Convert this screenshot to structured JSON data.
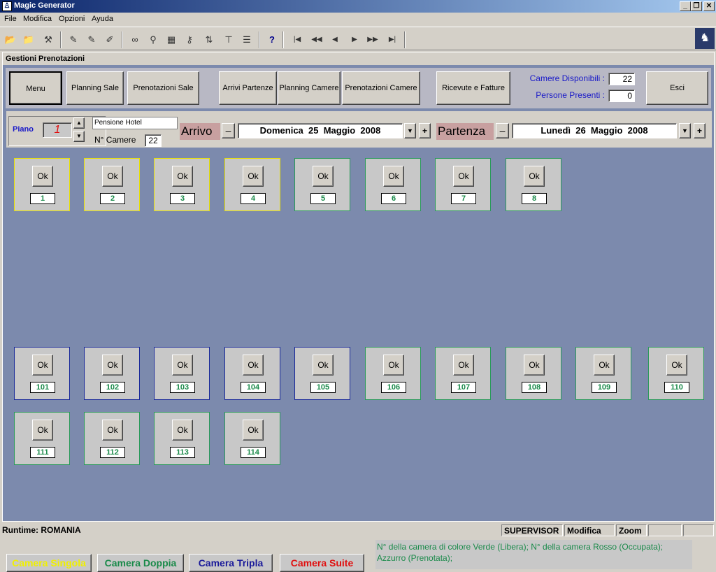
{
  "window": {
    "title": "Magic Generator"
  },
  "menu": [
    "File",
    "Modifica",
    "Opzioni",
    "Ayuda"
  ],
  "panel": {
    "title": "Gestioni Prenotazioni"
  },
  "buttons": {
    "menu": "Menu",
    "planning_sale": "Planning Sale",
    "prenotazioni_sale": "Prenotazioni Sale",
    "arrivi_partenze": "Arrivi Partenze",
    "planning_camere": "Planning Camere",
    "prenotazioni_camere": "Prenotazioni Camere",
    "ricevute_fatture": "Ricevute e Fatture",
    "esci": "Esci"
  },
  "info": {
    "camere_label": "Camere Disponibili :",
    "camere_value": "22",
    "persone_label": "Persone Presenti :",
    "persone_value": "0"
  },
  "floor": {
    "label": "Piano",
    "value": "1",
    "hotel_name": "Pensione Hotel",
    "camere_label": "N° Camere",
    "camere_value": "22"
  },
  "arrivo": {
    "label": "Arrivo",
    "date": "Domenica  25  Maggio  2008",
    "minus": "–",
    "plus": "+"
  },
  "partenza": {
    "label": "Partenza",
    "date": "Lunedì  26  Maggio  2008",
    "minus": "–",
    "plus": "+"
  },
  "ok_label": "Ok",
  "rooms_floor": [
    {
      "num": "1",
      "border": "#e8e000"
    },
    {
      "num": "2",
      "border": "#e8e000"
    },
    {
      "num": "3",
      "border": "#e8e000"
    },
    {
      "num": "4",
      "border": "#e8e000"
    },
    {
      "num": "5",
      "border": "#2a9a5a"
    },
    {
      "num": "6",
      "border": "#2a9a5a"
    },
    {
      "num": "7",
      "border": "#2a9a5a"
    },
    {
      "num": "8",
      "border": "#2a9a5a"
    }
  ],
  "rooms_100": [
    {
      "num": "101",
      "border": "#1a2a9a"
    },
    {
      "num": "102",
      "border": "#1a2a9a"
    },
    {
      "num": "103",
      "border": "#1a2a9a"
    },
    {
      "num": "104",
      "border": "#1a2a9a"
    },
    {
      "num": "105",
      "border": "#1a2a9a"
    },
    {
      "num": "106",
      "border": "#2a9a5a"
    },
    {
      "num": "107",
      "border": "#2a9a5a"
    },
    {
      "num": "108",
      "border": "#2a9a5a"
    },
    {
      "num": "109",
      "border": "#2a9a5a"
    },
    {
      "num": "110",
      "border": "#2a9a5a"
    },
    {
      "num": "111",
      "border": "#2a9a5a"
    },
    {
      "num": "112",
      "border": "#2a9a5a"
    },
    {
      "num": "113",
      "border": "#2a9a5a"
    },
    {
      "num": "114",
      "border": "#2a9a5a"
    }
  ],
  "legend": [
    {
      "label": "Camera Singola",
      "color": "#f0f000"
    },
    {
      "label": "Camera Doppia",
      "color": "#1a8a4a"
    },
    {
      "label": "Camera Tripla",
      "color": "#1a1a9a"
    },
    {
      "label": "Camera Suite",
      "color": "#e01010"
    }
  ],
  "note": "N° della camera di colore Verde (Libera); N° della camera Rosso (Occupata); Azzurro (Prenotata);",
  "status": {
    "runtime": "Runtime: ROMANIA",
    "user": "SUPERVISOR",
    "mode": "Modifica",
    "zoom": "Zoom"
  },
  "toolbar_icons": [
    "open-folder-icon",
    "open-folder-icon",
    "tools-icon",
    "pencil-icon",
    "pencil-add-icon",
    "pencil-icon",
    "binoculars-icon",
    "search-icon",
    "table-icon",
    "key-icon",
    "sort-icon",
    "filter-icon",
    "list-icon",
    "help-icon",
    "first-record-icon",
    "prev-page-icon",
    "prev-record-icon",
    "next-record-icon",
    "next-page-icon",
    "last-record-icon"
  ]
}
